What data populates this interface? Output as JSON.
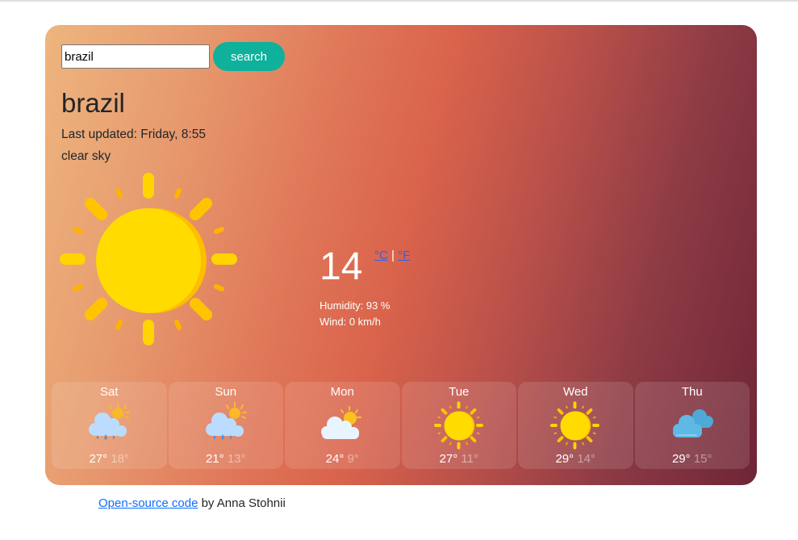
{
  "search": {
    "value": "brazil",
    "placeholder": "",
    "button_label": "search"
  },
  "current": {
    "city": "brazil",
    "last_updated": "Last updated: Friday, 8:55",
    "description": "clear sky",
    "icon": "sun-icon",
    "temperature": "14",
    "unit_celsius": "°C",
    "unit_separator": "|",
    "unit_fahrenheit": "°F",
    "humidity": "Humidity: 93 %",
    "wind": "Wind: 0 km/h"
  },
  "forecast": [
    {
      "day": "Sat",
      "icon": "rain-cloud-sun-icon",
      "max": "27°",
      "min": "18°"
    },
    {
      "day": "Sun",
      "icon": "rain-cloud-sun-icon",
      "max": "21°",
      "min": "13°"
    },
    {
      "day": "Mon",
      "icon": "partly-cloudy-icon",
      "max": "24°",
      "min": "9°"
    },
    {
      "day": "Tue",
      "icon": "sun-icon",
      "max": "27°",
      "min": "11°"
    },
    {
      "day": "Wed",
      "icon": "sun-icon",
      "max": "29°",
      "min": "14°"
    },
    {
      "day": "Thu",
      "icon": "clouds-icon",
      "max": "29°",
      "min": "15°"
    }
  ],
  "footer": {
    "link_text": "Open-source code",
    "suffix": " by Anna Stohnii"
  },
  "colors": {
    "accent": "#0fb19c",
    "gradient_start": "#eeb57e",
    "gradient_mid": "#d9634b",
    "gradient_end": "#6f2536",
    "link": "#0d6efd"
  }
}
